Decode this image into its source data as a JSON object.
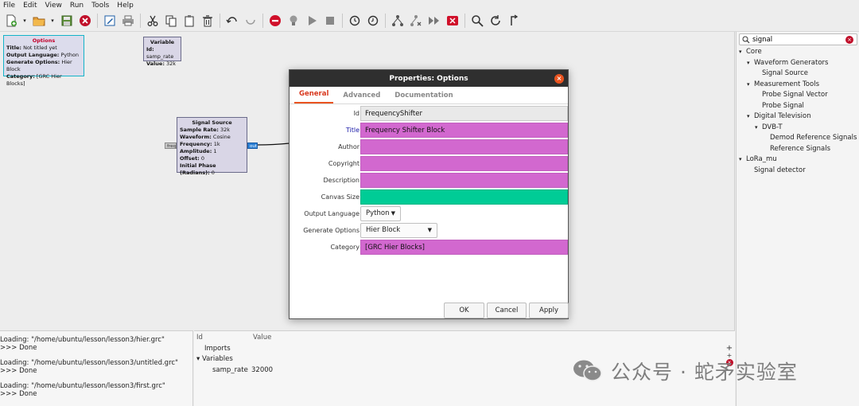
{
  "menubar": [
    "File",
    "Edit",
    "View",
    "Run",
    "Tools",
    "Help"
  ],
  "toolbar": {
    "icons": [
      "new-icon",
      "open-icon",
      "save-icon",
      "close-icon",
      "edit-icon",
      "print-icon",
      "cut-icon",
      "copy-icon",
      "paste-icon",
      "delete-icon",
      "undo-icon",
      "redo-icon",
      "errors-icon",
      "generate-icon",
      "run-icon",
      "stop-icon",
      "rotate-ccw-icon",
      "rotate-cw-icon",
      "enable-icon",
      "disable-icon",
      "bypass-icon",
      "kill-icon",
      "find-icon",
      "reload-icon",
      "create-hier-icon"
    ]
  },
  "canvas": {
    "options_block": {
      "title": "Options",
      "rows": [
        {
          "k": "Title:",
          "v": "Not titled yet"
        },
        {
          "k": "Output Language:",
          "v": "Python"
        },
        {
          "k": "Generate Options:",
          "v": "Hier Block"
        },
        {
          "k": "Category:",
          "v": "[GRC Hier Blocks]"
        }
      ]
    },
    "variable_block": {
      "title": "Variable",
      "rows": [
        {
          "k": "Id:",
          "v": "samp_rate"
        },
        {
          "k": "Value:",
          "v": "32k"
        }
      ]
    },
    "signal_block": {
      "title": "Signal Source",
      "rows": [
        {
          "k": "Sample Rate:",
          "v": "32k"
        },
        {
          "k": "Waveform:",
          "v": "Cosine"
        },
        {
          "k": "Frequency:",
          "v": "1k"
        },
        {
          "k": "Amplitude:",
          "v": "1"
        },
        {
          "k": "Offset:",
          "v": "0"
        },
        {
          "k": "Initial Phase (Radians):",
          "v": "0"
        }
      ],
      "port_in": "freq",
      "port_out": "out"
    }
  },
  "dialog": {
    "title": "Properties: Options",
    "tabs": [
      "General",
      "Advanced",
      "Documentation"
    ],
    "active_tab": "General",
    "fields": {
      "id": {
        "label": "Id",
        "value": "FrequencyShifter"
      },
      "title": {
        "label": "Title",
        "value": "Frequency Shifter Block"
      },
      "author": {
        "label": "Author",
        "value": ""
      },
      "copyright": {
        "label": "Copyright",
        "value": ""
      },
      "description": {
        "label": "Description",
        "value": ""
      },
      "canvas_size": {
        "label": "Canvas Size",
        "value": ""
      },
      "output_language": {
        "label": "Output Language",
        "value": "Python"
      },
      "generate_options": {
        "label": "Generate Options",
        "value": "Hier Block"
      },
      "category": {
        "label": "Category",
        "value": "[GRC Hier Blocks]"
      }
    },
    "buttons": {
      "ok": "OK",
      "cancel": "Cancel",
      "apply": "Apply"
    },
    "colors": {
      "pink": "#d268cf",
      "green": "#00cc96",
      "accent": "#e95420"
    }
  },
  "library": {
    "search_value": "signal",
    "tree": [
      {
        "label": "Core",
        "level": 0,
        "arrow": "▾"
      },
      {
        "label": "Waveform Generators",
        "level": 1,
        "arrow": "▾"
      },
      {
        "label": "Signal Source",
        "level": 2,
        "arrow": ""
      },
      {
        "label": "Measurement Tools",
        "level": 1,
        "arrow": "▾"
      },
      {
        "label": "Probe Signal Vector",
        "level": 2,
        "arrow": ""
      },
      {
        "label": "Probe Signal",
        "level": 2,
        "arrow": ""
      },
      {
        "label": "Digital Television",
        "level": 1,
        "arrow": "▾"
      },
      {
        "label": "DVB-T",
        "level": 2,
        "arrow": "▾"
      },
      {
        "label": "Demod Reference Signals",
        "level": 3,
        "arrow": ""
      },
      {
        "label": "Reference Signals",
        "level": 3,
        "arrow": ""
      },
      {
        "label": "LoRa_mu",
        "level": 0,
        "arrow": "▾"
      },
      {
        "label": "Signal detector",
        "level": 1,
        "arrow": ""
      }
    ]
  },
  "console": {
    "lines": [
      "Loading: \"/home/ubuntu/lesson/lesson3/hier.grc\"",
      ">>> Done",
      "",
      "Loading: \"/home/ubuntu/lesson/lesson3/untitled.grc\"",
      ">>> Done",
      "",
      "Loading: \"/home/ubuntu/lesson/lesson3/first.grc\"",
      ">>> Done"
    ]
  },
  "variables_panel": {
    "col_id": "Id",
    "col_value": "Value",
    "imports": "Imports",
    "variables": "Variables",
    "rows": [
      {
        "id": "samp_rate",
        "value": "32000"
      }
    ]
  },
  "watermark": "公众号 · 蛇矛实验室"
}
